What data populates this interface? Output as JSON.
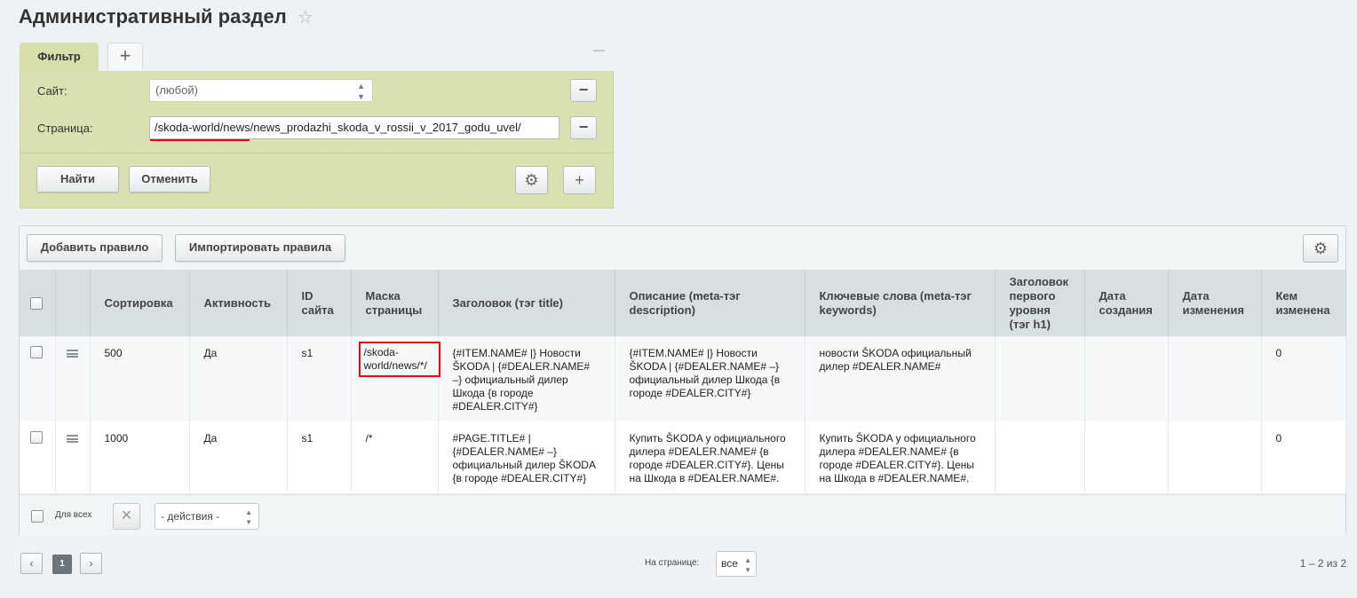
{
  "page": {
    "title": "Административный раздел"
  },
  "filter": {
    "tab_label": "Фильтр",
    "add_tab_symbol": "+",
    "site_label": "Сайт:",
    "site_value": "(любой)",
    "page_label": "Страница:",
    "page_value": "/skoda-world/news/news_prodazhi_skoda_v_rossii_v_2017_godu_uvel/",
    "find_button": "Найти",
    "cancel_button": "Отменить"
  },
  "toolbar": {
    "add_rule": "Добавить правило",
    "import_rules": "Импортировать правила"
  },
  "table": {
    "columns": [
      "Сортировка",
      "Активность",
      "ID сайта",
      "Маска страницы",
      "Заголовок (тэг title)",
      "Описание (meta-тэг description)",
      "Ключевые слова (meta-тэг keywords)",
      "Заголовок первого уровня (тэг h1)",
      "Дата создания",
      "Дата изменения",
      "Кем изменена"
    ],
    "rows": [
      {
        "sort": "500",
        "active": "Да",
        "site_id": "s1",
        "mask": "/skoda-world/news/*/",
        "title": "{#ITEM.NAME# |} Новости ŠKODA | {#DEALER.NAME# –} официальный дилер Шкода {в городе #DEALER.CITY#}",
        "description": "{#ITEM.NAME# |} Новости ŠKODA | {#DEALER.NAME# –} официальный дилер Шкода {в городе #DEALER.CITY#}",
        "keywords": "новости ŠKODA официальный дилер #DEALER.NAME#",
        "h1": "",
        "created": "",
        "modified": "",
        "modified_by": "0"
      },
      {
        "sort": "1000",
        "active": "Да",
        "site_id": "s1",
        "mask": "/*",
        "title": "#PAGE.TITLE# | {#DEALER.NAME# –} официальный дилер ŠKODA {в городе #DEALER.CITY#}",
        "description": "Купить ŠKODA у официального дилера #DEALER.NAME# {в городе #DEALER.CITY#}. Цены на Шкода в #DEALER.NAME#.",
        "keywords": "Купить ŠKODA у официального дилера #DEALER.NAME# {в городе #DEALER.CITY#}. Цены на Шкода в #DEALER.NAME#.",
        "h1": "",
        "created": "",
        "modified": "",
        "modified_by": "0"
      }
    ]
  },
  "footer": {
    "for_all": "Для всех",
    "actions_value": "- действия -"
  },
  "pagination": {
    "current_page": "1",
    "per_page_label": "На странице:",
    "per_page_value": "все",
    "range_text": "1 – 2 из 2"
  },
  "colors": {
    "filter_bg": "#d8dfab",
    "highlight_red": "#e30613",
    "header_bg": "#d8dfe2"
  },
  "icons": [
    "star-icon",
    "plus-icon",
    "minus-icon",
    "gear-icon",
    "menu-icon",
    "close-icon",
    "chevron-left-icon",
    "chevron-right-icon"
  ]
}
